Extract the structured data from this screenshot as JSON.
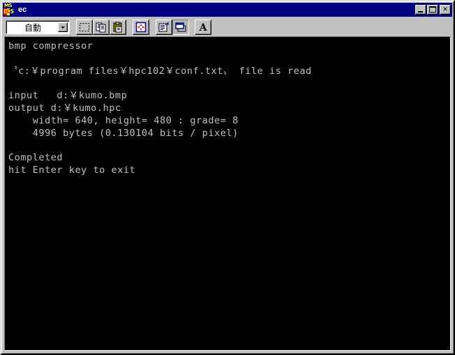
{
  "window": {
    "title": "ec",
    "icon": "msdos-icon",
    "icon_text_top": "MS",
    "icon_blocks": [
      "D",
      "O",
      "S"
    ],
    "controls": [
      {
        "name": "minimize-button",
        "label": "_"
      },
      {
        "name": "maximize-button",
        "label": "□"
      },
      {
        "name": "close-button",
        "label": "✕"
      }
    ]
  },
  "toolbar": {
    "font_size_selector": {
      "value": "自動",
      "options": [
        "自動"
      ]
    },
    "buttons": [
      {
        "name": "mark-button",
        "icon": "mark-icon",
        "state": "raised"
      },
      {
        "name": "copy-button",
        "icon": "copy-icon",
        "state": "raised"
      },
      {
        "name": "paste-button",
        "icon": "paste-icon",
        "state": "raised"
      },
      {
        "name": "full-screen-button",
        "icon": "fullscreen-icon",
        "state": "raised"
      },
      {
        "name": "properties-button",
        "icon": "properties-icon",
        "state": "raised"
      },
      {
        "name": "background-button",
        "icon": "background-icon",
        "state": "pressed"
      },
      {
        "name": "font-button",
        "icon": "font-a-icon",
        "state": "raised"
      }
    ]
  },
  "console": {
    "foreground_color": "#c0c0c0",
    "background_color": "#000000",
    "lines": [
      "bmp compressor",
      "",
      "〝c:￥program files￥hpc102￥conf.txt〟 file is read",
      "",
      "input   d:￥kumo.bmp",
      "output d:￥kumo.hpc",
      "    width= 640, height= 480 : grade= 8",
      "    4996 bytes (0.130104 bits / pixel)",
      "",
      "Completed",
      "hit Enter key to exit"
    ],
    "program_name": "bmp compressor",
    "config_file": "c:￥program files￥hpc102￥conf.txt",
    "input_file": "d:￥kumo.bmp",
    "output_file": "d:￥kumo.hpc",
    "width": "640",
    "height": "480",
    "grade": "8",
    "bytes": "4996",
    "bits_per_pixel": "0.130104",
    "status": "Completed",
    "prompt": "hit Enter key to exit"
  },
  "colors": {
    "titlebar": "#000080",
    "window_face": "#c0c0c0",
    "console_fg": "#c0c0c0",
    "console_bg": "#000000"
  }
}
